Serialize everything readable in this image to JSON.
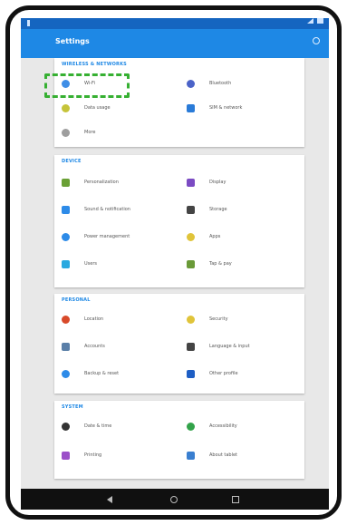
{
  "toolbar": {
    "title": "Settings"
  },
  "sections": [
    {
      "title": "WIRELESS & NETWORKS",
      "tiles": [
        {
          "label": "Wi-Fi",
          "icon": "wifi-icon",
          "color": "#3f8ee6",
          "shape": "circle"
        },
        {
          "label": "Bluetooth",
          "icon": "bluetooth-icon",
          "color": "#4b63c8",
          "shape": "circle"
        },
        {
          "label": "Data usage",
          "icon": "data-usage-icon",
          "color": "#c6c43a",
          "shape": "circle"
        },
        {
          "label": "SIM & network",
          "icon": "sim-card-icon",
          "color": "#2a7bd8",
          "shape": "square"
        },
        {
          "label": "More",
          "icon": "more-icon",
          "color": "#9e9e9e",
          "shape": "circle"
        }
      ]
    },
    {
      "title": "DEVICE",
      "tiles": [
        {
          "label": "Personalization",
          "icon": "personalization-icon",
          "color": "#6aa035",
          "shape": "square"
        },
        {
          "label": "Display",
          "icon": "display-icon",
          "color": "#7b4bc3",
          "shape": "square"
        },
        {
          "label": "Sound & notification",
          "icon": "sound-icon",
          "color": "#2d8be8",
          "shape": "square"
        },
        {
          "label": "Storage",
          "icon": "storage-icon",
          "color": "#444444",
          "shape": "square"
        },
        {
          "label": "Power management",
          "icon": "power-icon",
          "color": "#2d8be8",
          "shape": "circle"
        },
        {
          "label": "Apps",
          "icon": "apps-icon",
          "color": "#e0c43a",
          "shape": "circle"
        },
        {
          "label": "Users",
          "icon": "users-icon",
          "color": "#2aa9e0",
          "shape": "square"
        },
        {
          "label": "Tap & pay",
          "icon": "tap-pay-icon",
          "color": "#6a9a38",
          "shape": "square"
        }
      ]
    },
    {
      "title": "PERSONAL",
      "tiles": [
        {
          "label": "Location",
          "icon": "location-icon",
          "color": "#d84a2a",
          "shape": "circle"
        },
        {
          "label": "Security",
          "icon": "security-icon",
          "color": "#e0c43a",
          "shape": "circle"
        },
        {
          "label": "Accounts",
          "icon": "accounts-icon",
          "color": "#5a7fa8",
          "shape": "square"
        },
        {
          "label": "Language & input",
          "icon": "language-icon",
          "color": "#444444",
          "shape": "square"
        },
        {
          "label": "Backup & reset",
          "icon": "backup-icon",
          "color": "#2d8be8",
          "shape": "circle"
        },
        {
          "label": "Other profile",
          "icon": "profile-icon",
          "color": "#1e5ec4",
          "shape": "square"
        }
      ]
    },
    {
      "title": "SYSTEM",
      "tiles": [
        {
          "label": "Date & time",
          "icon": "date-time-icon",
          "color": "#333333",
          "shape": "circle"
        },
        {
          "label": "Accessibility",
          "icon": "accessibility-icon",
          "color": "#33a34a",
          "shape": "circle"
        },
        {
          "label": "Printing",
          "icon": "printing-icon",
          "color": "#9b4fc8",
          "shape": "square"
        },
        {
          "label": "About tablet",
          "icon": "about-tablet-icon",
          "color": "#3a7fd0",
          "shape": "square"
        }
      ]
    }
  ]
}
